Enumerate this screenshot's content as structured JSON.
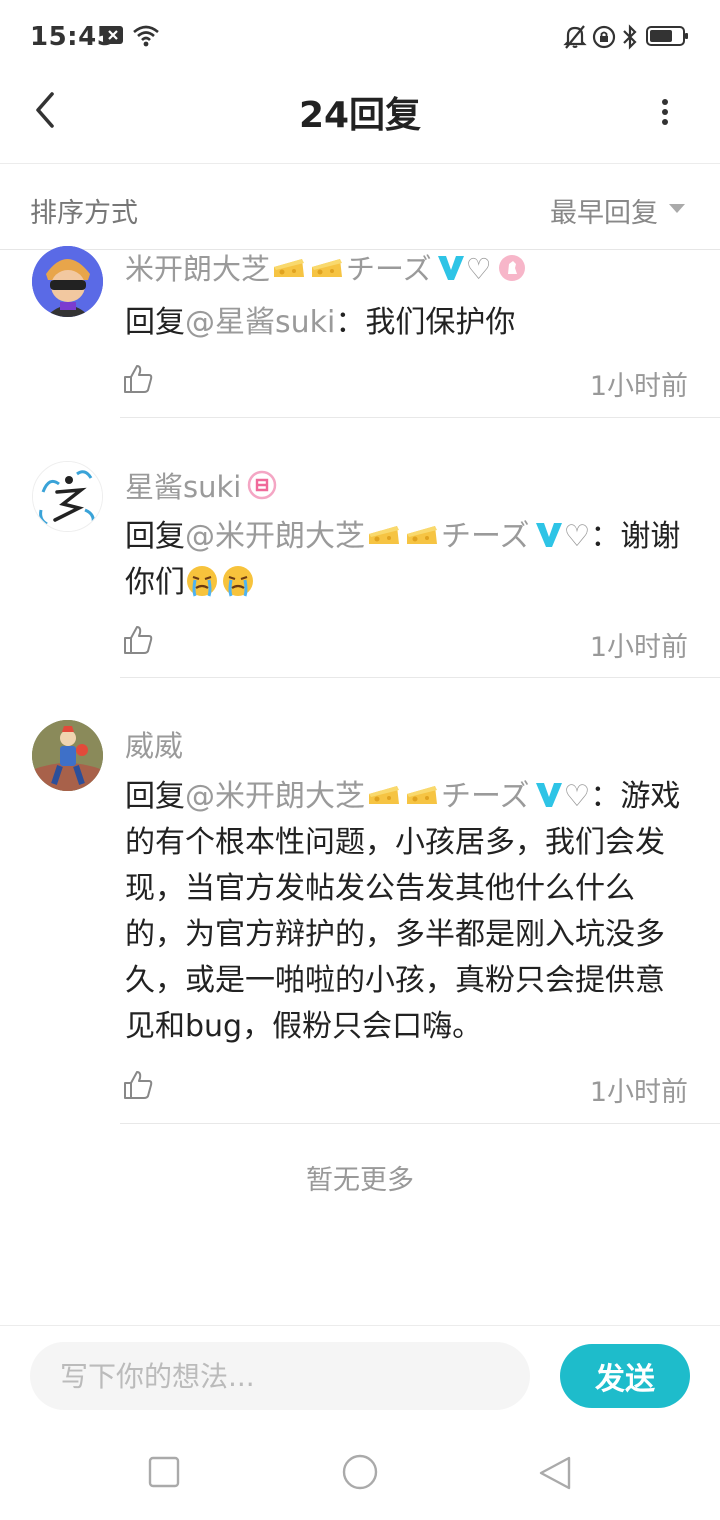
{
  "status_bar": {
    "time": "15:45",
    "left_icons": [
      "notification-x-icon",
      "wifi-icon"
    ],
    "right_icons": [
      "mute-bell-icon",
      "rotation-lock-icon",
      "bluetooth-icon",
      "battery-icon"
    ]
  },
  "header": {
    "title": "24回复",
    "back_icon": "back-arrow-icon",
    "more_icon": "more-vertical-icon"
  },
  "sort": {
    "label": "排序方式",
    "value": "最早回复"
  },
  "replies": [
    {
      "name": "米开朗大芝",
      "name_suffix": "チーズ",
      "heart": "♡",
      "has_v_badge": true,
      "prefix": "回复",
      "mention": "@星酱suki",
      "colon": "：",
      "content": "我们保护你",
      "time": "1小时前"
    },
    {
      "name": "星酱suki",
      "prefix": "回复",
      "mention_name": "@米开朗大芝",
      "mention_suffix": "チーズ",
      "heart": "♡",
      "colon": "：",
      "content": "谢谢你们",
      "time": "1小时前"
    },
    {
      "name": "威威",
      "prefix": "回复",
      "mention_name": "@米开朗大芝",
      "mention_suffix": "チーズ",
      "heart": "♡",
      "colon": "：",
      "content": "游戏的有个根本性问题，小孩居多，我们会发现，当官方发帖发公告发其他什么什么的，为官方辩护的，多半都是刚入坑没多久，或是一啪啦的小孩，真粉只会提供意见和bug，假粉只会口嗨。",
      "time": "1小时前"
    }
  ],
  "no_more": "暂无更多",
  "composer": {
    "placeholder": "写下你的想法...",
    "value": "",
    "send_label": "发送"
  },
  "colors": {
    "accent": "#1ebccb",
    "v_badge": "#2ec4e6",
    "muted_text": "#9a9a9a"
  },
  "nav_bar": [
    "recent-apps-icon",
    "home-icon",
    "back-triangle-icon"
  ]
}
